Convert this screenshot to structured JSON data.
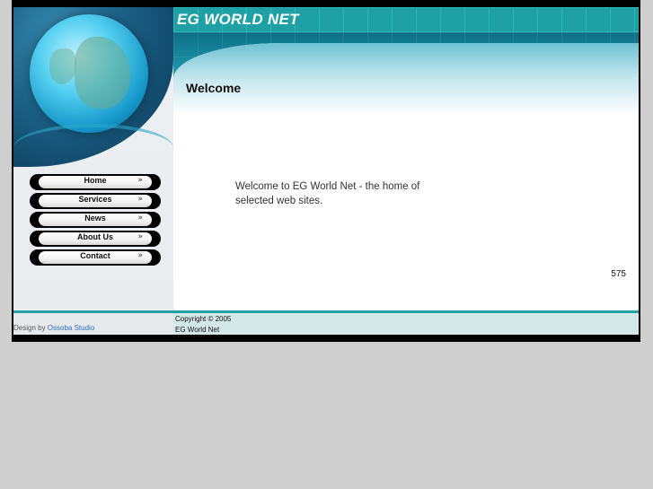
{
  "site": {
    "title": "EG WORLD NET"
  },
  "nav": {
    "items": [
      {
        "label": "Home"
      },
      {
        "label": "Services"
      },
      {
        "label": "News"
      },
      {
        "label": "About Us"
      },
      {
        "label": "Contact"
      }
    ],
    "chevron_icon": "double-chevron-right-icon"
  },
  "main": {
    "heading": "Welcome",
    "body": "Welcome to EG World Net - the home of selected web sites.",
    "counter": "575"
  },
  "footer": {
    "design_prefix": "Design by ",
    "design_link": "Ossoba Studio",
    "copyright_line1": "Copyright © 2005",
    "copyright_line2": "EG World Net"
  },
  "colors": {
    "accent_teal": "#1fa0a4",
    "frame": "#000000",
    "page_bg": "#cfcfcf"
  }
}
